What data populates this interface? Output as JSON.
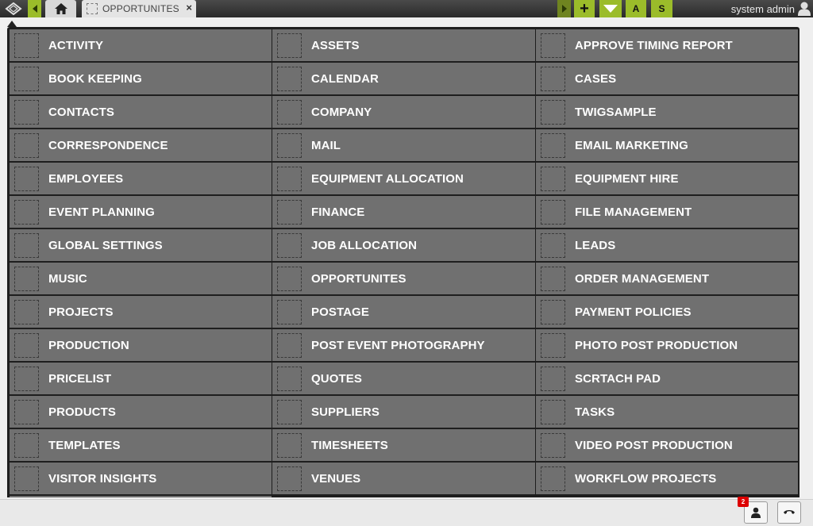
{
  "header": {
    "tab_label": "OPPORTUNITES",
    "tab_close": "×",
    "plus_label": "+",
    "a_label": "A",
    "s_label": "S",
    "user_name": "system admin"
  },
  "modules": [
    "ACTIVITY",
    "ASSETS",
    "APPROVE TIMING REPORT",
    "BOOK KEEPING",
    "CALENDAR",
    "CASES",
    "CONTACTS",
    "COMPANY",
    "TWIGSAMPLE",
    "CORRESPONDENCE",
    "MAIL",
    "EMAIL MARKETING",
    "EMPLOYEES",
    "EQUIPMENT ALLOCATION",
    "EQUIPMENT HIRE",
    "EVENT PLANNING",
    "FINANCE",
    "FILE MANAGEMENT",
    "GLOBAL SETTINGS",
    "JOB ALLOCATION",
    "LEADS",
    "MUSIC",
    "OPPORTUNITES",
    "ORDER MANAGEMENT",
    "PROJECTS",
    "POSTAGE",
    "PAYMENT POLICIES",
    "PRODUCTION",
    "POST EVENT PHOTOGRAPHY",
    "PHOTO POST PRODUCTION",
    "PRICELIST",
    "QUOTES",
    "SCRTACH PAD",
    "PRODUCTS",
    "SUPPLIERS",
    "TASKS",
    "TEMPLATES",
    "TIMESHEETS",
    "VIDEO POST PRODUCTION",
    "VISITOR INSIGHTS",
    "VENUES",
    "WORKFLOW PROJECTS"
  ],
  "footer": {
    "notification_count": "2"
  },
  "colors": {
    "accent": "#9bbc2a",
    "tile": "#707070",
    "panel": "#1e1e1e",
    "badge": "#dd0000"
  },
  "icons": [
    "diamond-logo-icon",
    "back-arrow-icon",
    "home-icon",
    "forward-arrow-icon",
    "dropdown-arrow-icon",
    "user-icon",
    "contact-card-icon",
    "phone-icon"
  ]
}
